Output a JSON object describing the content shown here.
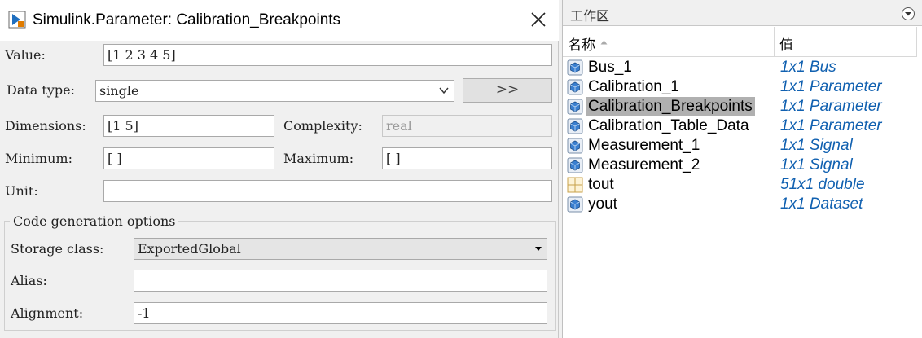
{
  "dialog": {
    "title": "Simulink.Parameter: Calibration_Breakpoints",
    "value_label": "Value:",
    "value": "[1 2 3 4 5]",
    "datatype_label": "Data type:",
    "datatype": "single",
    "more_button": ">>",
    "dimensions_label": "Dimensions:",
    "dimensions": "[1 5]",
    "complexity_label": "Complexity:",
    "complexity": "real",
    "minimum_label": "Minimum:",
    "minimum": "[ ]",
    "maximum_label": "Maximum:",
    "maximum": "[ ]",
    "unit_label": "Unit:",
    "unit": "",
    "codegen": {
      "legend": "Code generation options",
      "storage_label": "Storage class:",
      "storage": "ExportedGlobal",
      "alias_label": "Alias:",
      "alias": "",
      "alignment_label": "Alignment:",
      "alignment": "-1"
    }
  },
  "workspace": {
    "title": "工作区",
    "col_name": "名称",
    "col_value": "值",
    "rows": [
      {
        "name": "Bus_1",
        "value": "1x1 Bus",
        "icon": "object-icon"
      },
      {
        "name": "Calibration_1",
        "value": "1x1 Parameter",
        "icon": "object-icon"
      },
      {
        "name": "Calibration_Breakpoints",
        "value": "1x1 Parameter",
        "icon": "object-icon",
        "selected": true
      },
      {
        "name": "Calibration_Table_Data",
        "value": "1x1 Parameter",
        "icon": "object-icon"
      },
      {
        "name": "Measurement_1",
        "value": "1x1 Signal",
        "icon": "object-icon"
      },
      {
        "name": "Measurement_2",
        "value": "1x1 Signal",
        "icon": "object-icon"
      },
      {
        "name": "tout",
        "value": "51x1 double",
        "icon": "matrix-icon"
      },
      {
        "name": "yout",
        "value": "1x1 Dataset",
        "icon": "object-icon"
      }
    ]
  }
}
